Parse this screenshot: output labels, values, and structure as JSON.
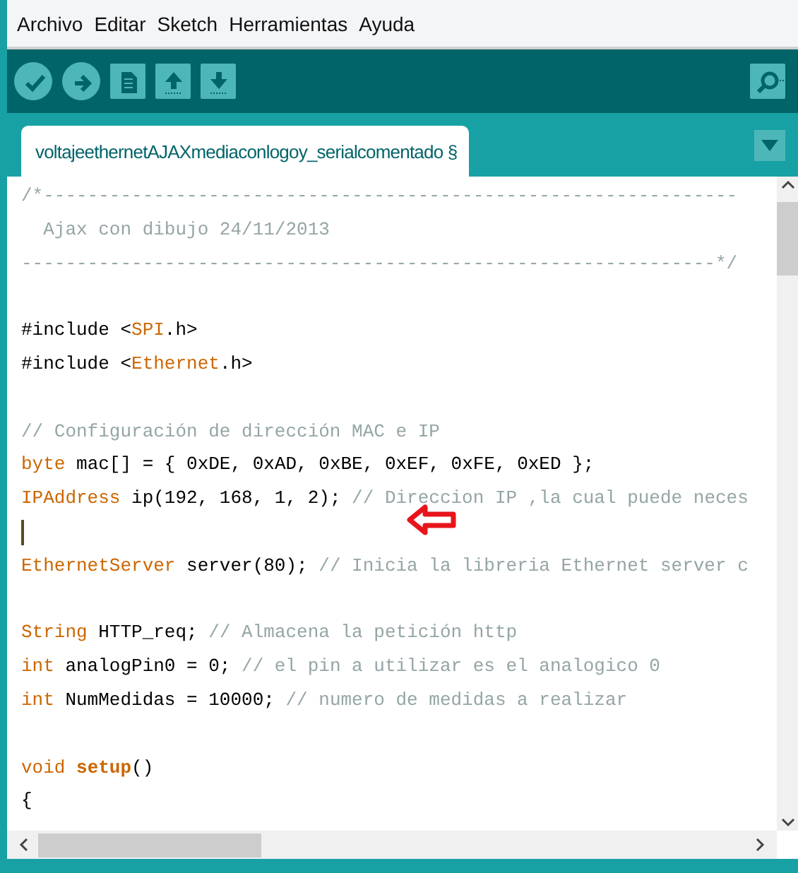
{
  "menu": [
    {
      "label": "Archivo"
    },
    {
      "label": "Editar"
    },
    {
      "label": "Sketch"
    },
    {
      "label": "Herramientas"
    },
    {
      "label": "Ayuda"
    }
  ],
  "toolbar": [
    {
      "kind": "verify"
    },
    {
      "kind": "upload"
    },
    {
      "kind": "new"
    },
    {
      "kind": "open"
    },
    {
      "kind": "save"
    },
    {
      "kind": "monitor"
    }
  ],
  "tabs": [
    {
      "label": "voltajeethernetAJAXmediaconlogoy_serialcomentado §",
      "selected": true
    }
  ],
  "editor": {
    "lines": [
      {
        "kind": "code",
        "segments": [
          {
            "kind": "comment",
            "text": "/*---------------------------------------------------------------"
          }
        ]
      },
      {
        "kind": "code",
        "segments": [
          {
            "kind": "comment",
            "text": "  Ajax con dibujo 24/11/2013"
          }
        ]
      },
      {
        "kind": "code",
        "segments": [
          {
            "kind": "comment",
            "text": "---------------------------------------------------------------*/"
          }
        ]
      },
      {
        "kind": "blank"
      },
      {
        "kind": "code",
        "segments": [
          {
            "kind": "text",
            "text": "#include <"
          },
          {
            "kind": "type",
            "text": "SPI"
          },
          {
            "kind": "text",
            "text": ".h>"
          }
        ]
      },
      {
        "kind": "code",
        "segments": [
          {
            "kind": "text",
            "text": "#include <"
          },
          {
            "kind": "type",
            "text": "Ethernet"
          },
          {
            "kind": "text",
            "text": ".h>"
          }
        ]
      },
      {
        "kind": "blank"
      },
      {
        "kind": "code",
        "segments": [
          {
            "kind": "comment",
            "text": "// Configuración de dirección MAC e IP"
          }
        ]
      },
      {
        "kind": "code",
        "segments": [
          {
            "kind": "type",
            "text": "byte"
          },
          {
            "kind": "text",
            "text": " mac[] = { 0xDE, 0xAD, 0xBE, 0xEF, 0xFE, 0xED };"
          }
        ]
      },
      {
        "kind": "code",
        "segments": [
          {
            "kind": "type",
            "text": "IPAddress"
          },
          {
            "kind": "text",
            "text": " ip(192, 168, 1, 2); "
          },
          {
            "kind": "comment",
            "text": "// Direccion IP ,la cual puede neces"
          }
        ]
      },
      {
        "kind": "cursor"
      },
      {
        "kind": "code",
        "segments": [
          {
            "kind": "type",
            "text": "EthernetServer"
          },
          {
            "kind": "text",
            "text": " server(80); "
          },
          {
            "kind": "comment",
            "text": "// Inicia la libreria Ethernet server c"
          }
        ]
      },
      {
        "kind": "blank"
      },
      {
        "kind": "code",
        "segments": [
          {
            "kind": "type",
            "text": "String"
          },
          {
            "kind": "text",
            "text": " HTTP_req; "
          },
          {
            "kind": "comment",
            "text": "// Almacena la petición http"
          }
        ]
      },
      {
        "kind": "code",
        "segments": [
          {
            "kind": "type",
            "text": "int"
          },
          {
            "kind": "text",
            "text": " analogPin0 = 0; "
          },
          {
            "kind": "comment",
            "text": "// el pin a utilizar es el analogico 0"
          }
        ]
      },
      {
        "kind": "code",
        "segments": [
          {
            "kind": "type",
            "text": "int"
          },
          {
            "kind": "text",
            "text": " NumMedidas = 10000; "
          },
          {
            "kind": "comment",
            "text": "// numero de medidas a realizar"
          }
        ]
      },
      {
        "kind": "blank"
      },
      {
        "kind": "code",
        "segments": [
          {
            "kind": "type",
            "text": "void"
          },
          {
            "kind": "func",
            "text": " setup"
          },
          {
            "kind": "text",
            "text": "()"
          }
        ]
      },
      {
        "kind": "code",
        "segments": [
          {
            "kind": "text",
            "text": "{"
          }
        ]
      }
    ]
  }
}
